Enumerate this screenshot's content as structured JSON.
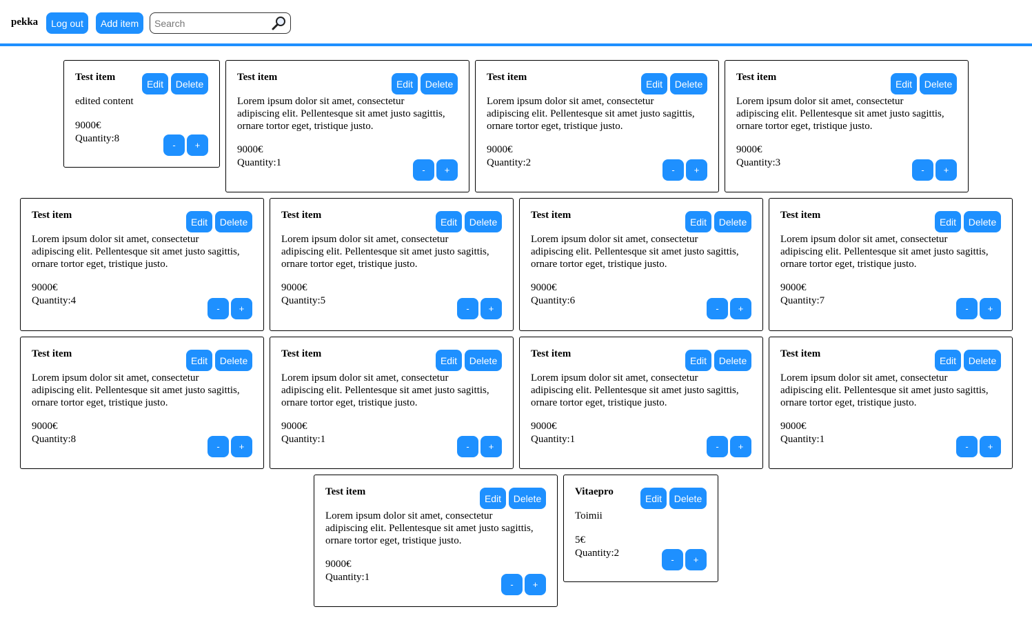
{
  "header": {
    "username": "pekka",
    "logout_label": "Log out",
    "add_item_label": "Add item",
    "search_placeholder": "Search",
    "search_value": "",
    "search_icon": "magnifier-icon"
  },
  "lorem": "Lorem ipsum dolor sit amet, consectetur adipiscing elit. Pellentesque sit amet justo sagittis, ornare tortor eget, tristique justo.",
  "items": [
    {
      "title": "Test item",
      "description": "edited content",
      "price": "9000€",
      "quantity": "Quantity:8"
    },
    {
      "title": "Test item",
      "description": "Lorem ipsum dolor sit amet, consectetur adipiscing elit. Pellentesque sit amet justo sagittis, ornare tortor eget, tristique justo.",
      "price": "9000€",
      "quantity": "Quantity:1"
    },
    {
      "title": "Test item",
      "description": "Lorem ipsum dolor sit amet, consectetur adipiscing elit. Pellentesque sit amet justo sagittis, ornare tortor eget, tristique justo.",
      "price": "9000€",
      "quantity": "Quantity:2"
    },
    {
      "title": "Test item",
      "description": "Lorem ipsum dolor sit amet, consectetur adipiscing elit. Pellentesque sit amet justo sagittis, ornare tortor eget, tristique justo.",
      "price": "9000€",
      "quantity": "Quantity:3"
    },
    {
      "title": "Test item",
      "description": "Lorem ipsum dolor sit amet, consectetur adipiscing elit. Pellentesque sit amet justo sagittis, ornare tortor eget, tristique justo.",
      "price": "9000€",
      "quantity": "Quantity:4"
    },
    {
      "title": "Test item",
      "description": "Lorem ipsum dolor sit amet, consectetur adipiscing elit. Pellentesque sit amet justo sagittis, ornare tortor eget, tristique justo.",
      "price": "9000€",
      "quantity": "Quantity:5"
    },
    {
      "title": "Test item",
      "description": "Lorem ipsum dolor sit amet, consectetur adipiscing elit. Pellentesque sit amet justo sagittis, ornare tortor eget, tristique justo.",
      "price": "9000€",
      "quantity": "Quantity:6"
    },
    {
      "title": "Test item",
      "description": "Lorem ipsum dolor sit amet, consectetur adipiscing elit. Pellentesque sit amet justo sagittis, ornare tortor eget, tristique justo.",
      "price": "9000€",
      "quantity": "Quantity:7"
    },
    {
      "title": "Test item",
      "description": "Lorem ipsum dolor sit amet, consectetur adipiscing elit. Pellentesque sit amet justo sagittis, ornare tortor eget, tristique justo.",
      "price": "9000€",
      "quantity": "Quantity:8"
    },
    {
      "title": "Test item",
      "description": "Lorem ipsum dolor sit amet, consectetur adipiscing elit. Pellentesque sit amet justo sagittis, ornare tortor eget, tristique justo.",
      "price": "9000€",
      "quantity": "Quantity:1"
    },
    {
      "title": "Test item",
      "description": "Lorem ipsum dolor sit amet, consectetur adipiscing elit. Pellentesque sit amet justo sagittis, ornare tortor eget, tristique justo.",
      "price": "9000€",
      "quantity": "Quantity:1"
    },
    {
      "title": "Test item",
      "description": "Lorem ipsum dolor sit amet, consectetur adipiscing elit. Pellentesque sit amet justo sagittis, ornare tortor eget, tristique justo.",
      "price": "9000€",
      "quantity": "Quantity:1"
    },
    {
      "title": "Test item",
      "description": "Lorem ipsum dolor sit amet, consectetur adipiscing elit. Pellentesque sit amet justo sagittis, ornare tortor eget, tristique justo.",
      "price": "9000€",
      "quantity": "Quantity:1"
    },
    {
      "title": "Vitaepro",
      "description": "Toimii",
      "price": "5€",
      "quantity": "Quantity:2"
    }
  ],
  "card_labels": {
    "edit": "Edit",
    "delete": "Delete",
    "decrement": "-",
    "increment": "+"
  },
  "colors": {
    "accent": "#1e90ff",
    "border": "#000000"
  }
}
